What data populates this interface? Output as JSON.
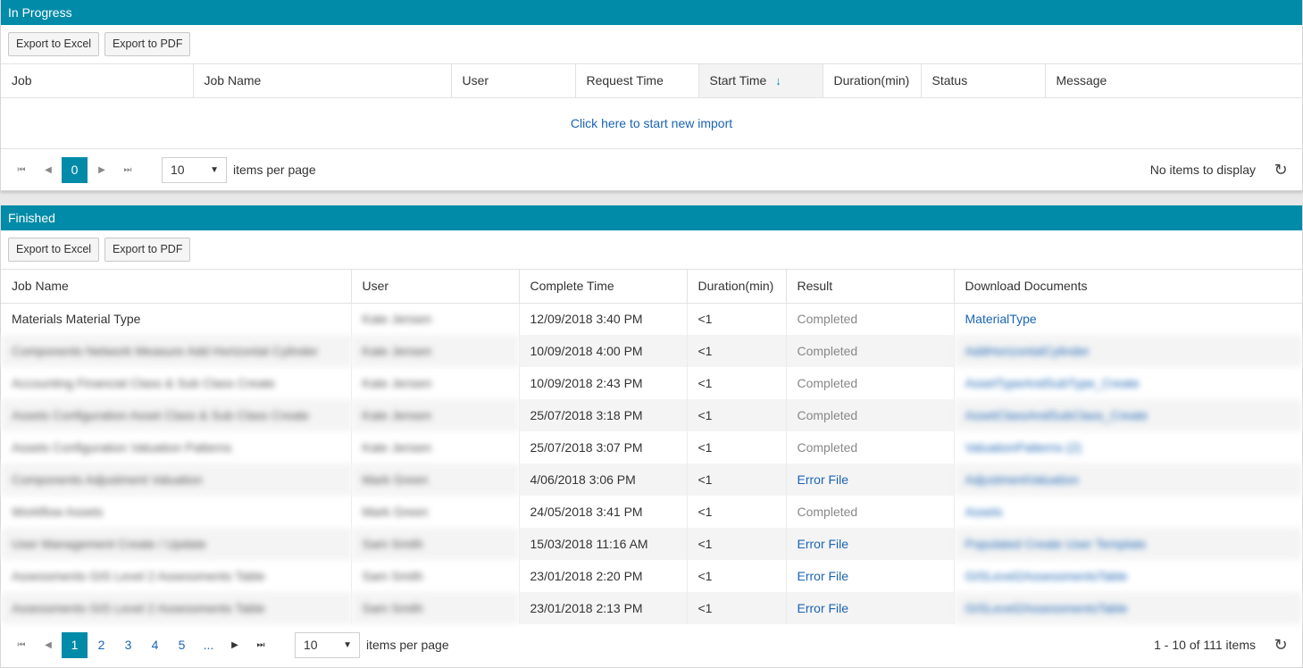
{
  "in_progress": {
    "title": "In Progress",
    "export_excel": "Export to Excel",
    "export_pdf": "Export to PDF",
    "columns": [
      "Job",
      "Job Name",
      "User",
      "Request Time",
      "Start Time",
      "Duration(min)",
      "Status",
      "Message"
    ],
    "sorted_column": "Start Time",
    "sort_icon": "arrow-down-icon",
    "empty_link": "Click here to start new import",
    "pager": {
      "current_page": "0",
      "page_size": "10",
      "per_page_label": "items per page",
      "info": "No items to display"
    }
  },
  "finished": {
    "title": "Finished",
    "export_excel": "Export to Excel",
    "export_pdf": "Export to PDF",
    "columns": [
      "Job Name",
      "User",
      "Complete Time",
      "Duration(min)",
      "Result",
      "Download Documents"
    ],
    "rows": [
      {
        "job_name": "Materials Material Type",
        "user": "Kate Jensen",
        "time": "12/09/2018 3:40 PM",
        "duration": "<1",
        "result": "Completed",
        "doc": "MaterialType"
      },
      {
        "job_name": "Components Network Measure Add Horizontal Cylinder",
        "user": "Kate Jensen",
        "time": "10/09/2018 4:00 PM",
        "duration": "<1",
        "result": "Completed",
        "doc": "AddHorizontalCylinder"
      },
      {
        "job_name": "Accounting Financial Class & Sub Class Create",
        "user": "Kate Jensen",
        "time": "10/09/2018 2:43 PM",
        "duration": "<1",
        "result": "Completed",
        "doc": "AssetTypeAndSubType_Create"
      },
      {
        "job_name": "Assets Configuration Asset Class & Sub Class Create",
        "user": "Kate Jensen",
        "time": "25/07/2018 3:18 PM",
        "duration": "<1",
        "result": "Completed",
        "doc": "AssetClassAndSubClass_Create"
      },
      {
        "job_name": "Assets Configuration Valuation Patterns",
        "user": "Kate Jensen",
        "time": "25/07/2018 3:07 PM",
        "duration": "<1",
        "result": "Completed",
        "doc": "ValuationPatterns (2)"
      },
      {
        "job_name": "Components Adjustment Valuation",
        "user": "Mark Green",
        "time": "4/06/2018 3:06 PM",
        "duration": "<1",
        "result": "Error File",
        "doc": "AdjustmentValuation"
      },
      {
        "job_name": "Workflow Assets",
        "user": "Mark Green",
        "time": "24/05/2018 3:41 PM",
        "duration": "<1",
        "result": "Completed",
        "doc": "Assets"
      },
      {
        "job_name": "User Management Create / Update",
        "user": "Sam Smith",
        "time": "15/03/2018 11:16 AM",
        "duration": "<1",
        "result": "Error File",
        "doc": "Populated Create User Template"
      },
      {
        "job_name": "Assessments GIS Level 2 Assessments Table",
        "user": "Sam Smith",
        "time": "23/01/2018 2:20 PM",
        "duration": "<1",
        "result": "Error File",
        "doc": "GISLevel2AssessmentsTable"
      },
      {
        "job_name": "Assessments GIS Level 2 Assessments Table",
        "user": "Sam Smith",
        "time": "23/01/2018 2:13 PM",
        "duration": "<1",
        "result": "Error File",
        "doc": "GISLevel2AssessmentsTable"
      }
    ],
    "pager": {
      "pages": [
        "1",
        "2",
        "3",
        "4",
        "5",
        "..."
      ],
      "current_page": "1",
      "page_size": "10",
      "per_page_label": "items per page",
      "info": "1 - 10 of 111 items"
    }
  },
  "colors": {
    "header": "#028ba8",
    "link": "#1a64b4"
  }
}
